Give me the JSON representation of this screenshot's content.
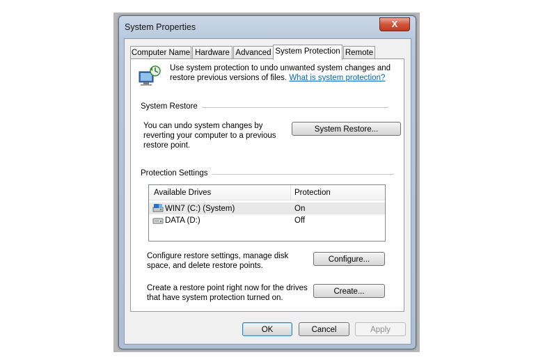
{
  "window": {
    "title": "System Properties",
    "close_label": "X"
  },
  "tabs": [
    {
      "label": "Computer Name"
    },
    {
      "label": "Hardware"
    },
    {
      "label": "Advanced"
    },
    {
      "label": "System Protection"
    },
    {
      "label": "Remote"
    }
  ],
  "active_tab": "System Protection",
  "intro": {
    "text": "Use system protection to undo unwanted system changes and restore previous versions of files.",
    "link": "What is system protection?"
  },
  "system_restore": {
    "heading": "System Restore",
    "description": "You can undo system changes by reverting your computer to a previous restore point.",
    "button": "System Restore..."
  },
  "protection_settings": {
    "heading": "Protection Settings",
    "columns": [
      "Available Drives",
      "Protection"
    ],
    "drives": [
      {
        "name": "WIN7 (C:) (System)",
        "protection": "On",
        "icon": "system-drive-icon"
      },
      {
        "name": "DATA (D:)",
        "protection": "Off",
        "icon": "hard-drive-icon"
      }
    ],
    "configure_text": "Configure restore settings, manage disk space, and delete restore points.",
    "configure_button": "Configure...",
    "create_text": "Create a restore point right now for the drives that have system protection turned on.",
    "create_button": "Create..."
  },
  "footer": {
    "ok": "OK",
    "cancel": "Cancel",
    "apply": "Apply"
  }
}
